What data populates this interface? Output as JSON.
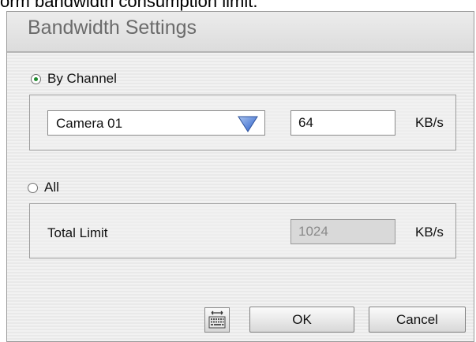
{
  "caption": "orm bandwidth consumption limit.",
  "dialog": {
    "title": "Bandwidth Settings",
    "by_channel": {
      "label": "By Channel",
      "selected": true,
      "camera_select": "Camera 01",
      "limit_value": "64",
      "unit": "KB/s"
    },
    "all": {
      "label": "All",
      "selected": false,
      "total_label": "Total Limit",
      "total_value": "1024",
      "unit": "KB/s"
    },
    "buttons": {
      "ok": "OK",
      "cancel": "Cancel"
    },
    "icons": {
      "keyboard": "keyboard-icon",
      "dropdown": "triangle-down-icon"
    },
    "colors": {
      "radio_selected": "#1f8a2f",
      "dropdown_arrow": "#3a6fd0"
    }
  }
}
